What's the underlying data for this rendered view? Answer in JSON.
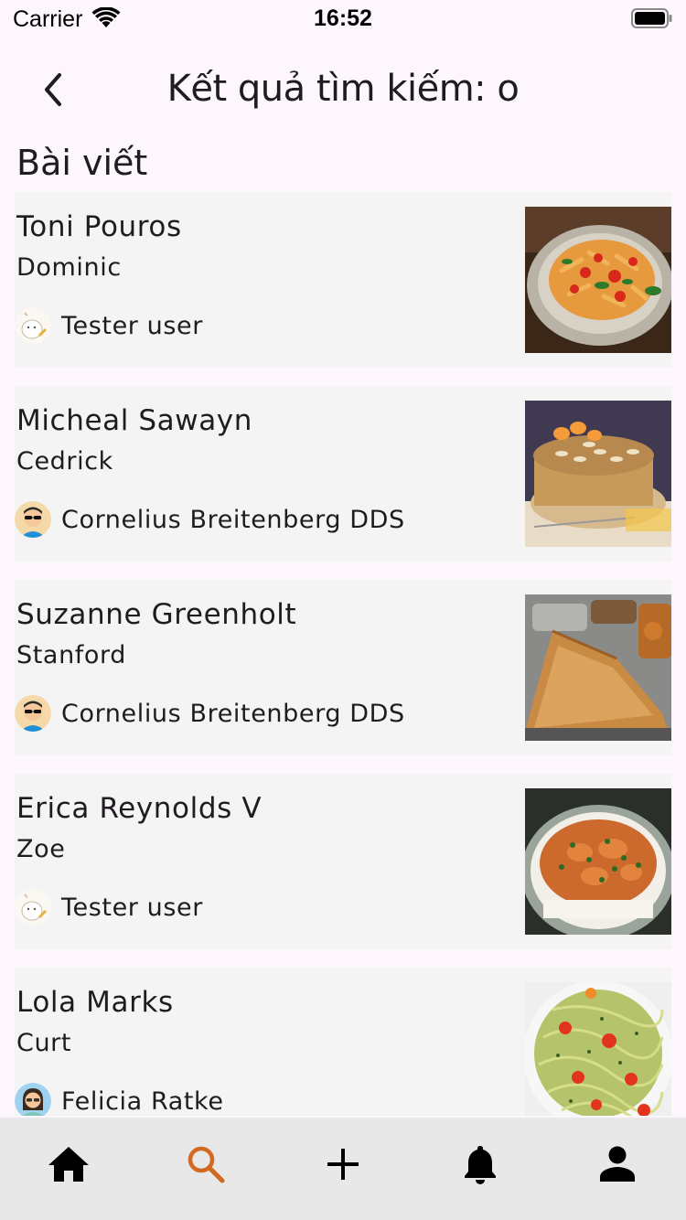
{
  "status_bar": {
    "carrier": "Carrier",
    "time": "16:52"
  },
  "header": {
    "title": "Kết quả tìm kiếm: o"
  },
  "section": {
    "title": "Bài viết"
  },
  "posts": [
    {
      "title": "Toni Pouros",
      "subtitle": "Dominic",
      "author": "Tester user",
      "avatar": "sketch-avatar",
      "image": "pasta-dish"
    },
    {
      "title": "Micheal Sawayn",
      "subtitle": "Cedrick",
      "author": "Cornelius Breitenberg DDS",
      "avatar": "sunglasses-avatar",
      "image": "cake-dish"
    },
    {
      "title": "Suzanne Greenholt",
      "subtitle": "Stanford",
      "author": "Cornelius Breitenberg DDS",
      "avatar": "sunglasses-avatar",
      "image": "dosa-dish"
    },
    {
      "title": "Erica Reynolds V",
      "subtitle": "Zoe",
      "author": "Tester user",
      "avatar": "sketch-avatar",
      "image": "curry-dish"
    },
    {
      "title": "Lola Marks",
      "subtitle": "Curt",
      "author": "Felicia Ratke",
      "avatar": "woman-avatar",
      "image": "pesto-spaghetti"
    }
  ],
  "tabbar": {
    "active_color": "#d2691e",
    "items": [
      {
        "icon": "home-icon"
      },
      {
        "icon": "search-icon",
        "active": true
      },
      {
        "icon": "plus-icon"
      },
      {
        "icon": "bell-icon"
      },
      {
        "icon": "person-icon"
      }
    ]
  }
}
